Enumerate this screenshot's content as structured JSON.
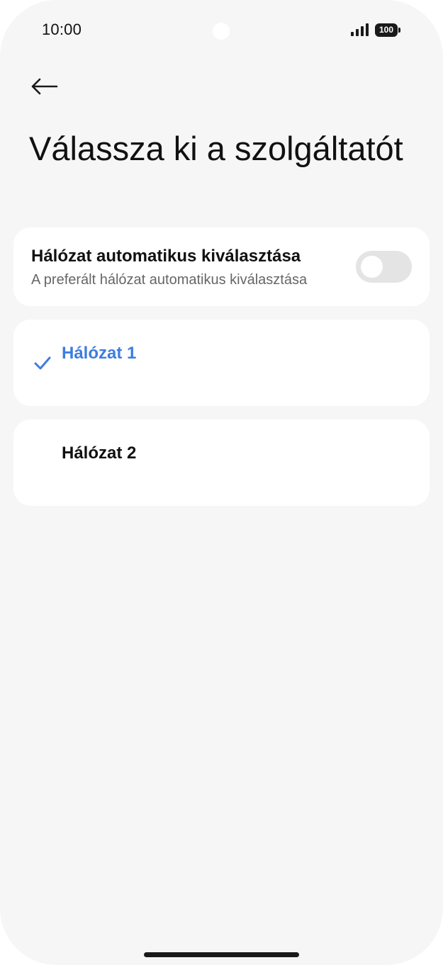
{
  "status_bar": {
    "time": "10:00",
    "battery": "100",
    "icons": [
      "signal-icon",
      "battery-icon"
    ]
  },
  "header": {
    "back_icon": "back-arrow-icon",
    "title": "Válassza ki a szolgáltatót"
  },
  "auto_select": {
    "title": "Hálózat automatikus kiválasztása",
    "subtitle": "A preferált hálózat automatikus kiválasztása",
    "toggle_on": false
  },
  "networks": [
    {
      "label": "Hálózat 1",
      "selected": true
    },
    {
      "label": "Hálózat 2",
      "selected": false
    }
  ],
  "colors": {
    "accent": "#3d7ddf",
    "background": "#f6f6f6",
    "card": "#ffffff",
    "toggle_off": "#e4e4e4"
  }
}
